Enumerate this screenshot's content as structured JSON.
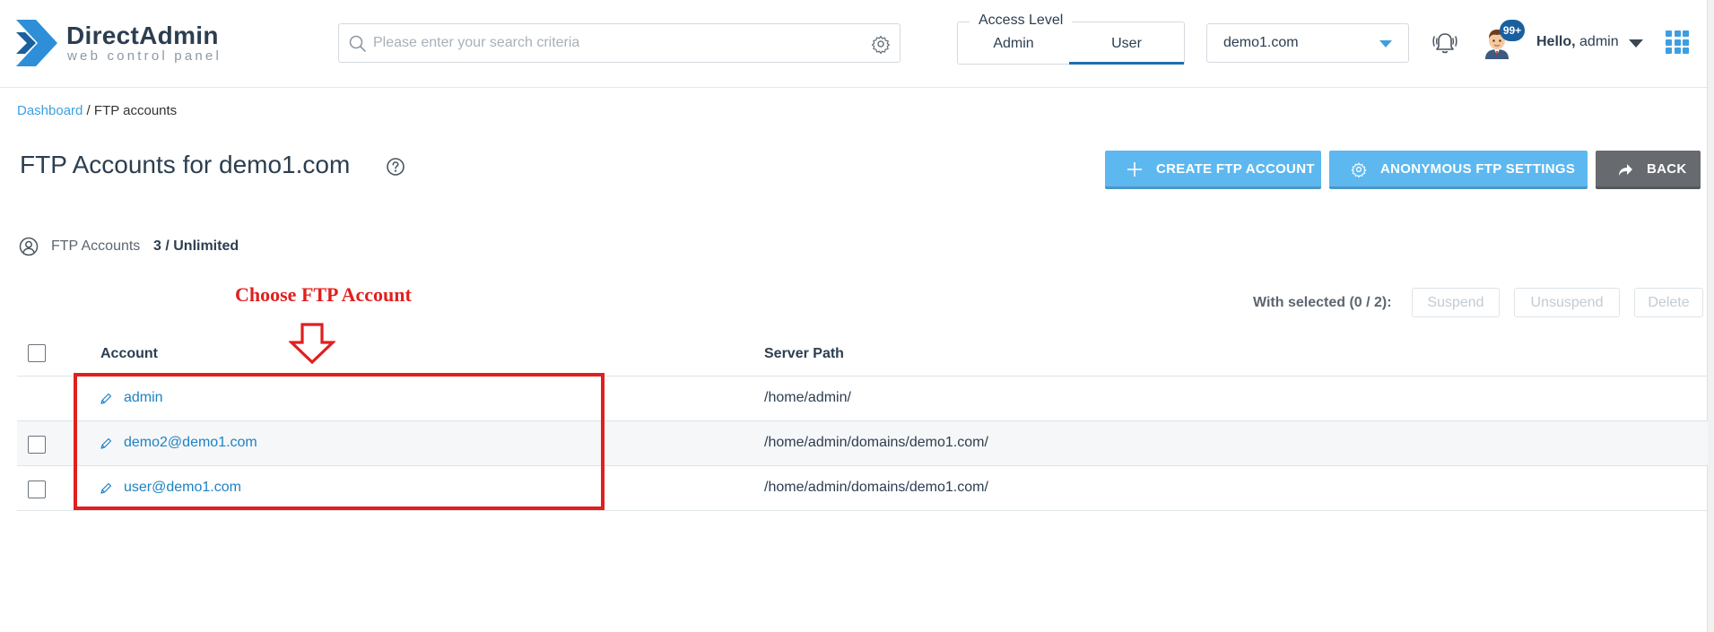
{
  "header": {
    "logo_title": "DirectAdmin",
    "logo_subtitle": "web control panel",
    "search_placeholder": "Please enter your search criteria",
    "access_level_label": "Access Level",
    "access_tabs": [
      "Admin",
      "User"
    ],
    "access_active": "User",
    "domain_selected": "demo1.com",
    "notification_badge": "99+",
    "hello_prefix": "Hello,",
    "hello_user": "admin"
  },
  "breadcrumb": {
    "root": "Dashboard",
    "separator": " / ",
    "current": "FTP accounts"
  },
  "page": {
    "title": "FTP Accounts for demo1.com"
  },
  "actions": {
    "create": "CREATE FTP ACCOUNT",
    "anonymous": "ANONYMOUS FTP SETTINGS",
    "back": "BACK"
  },
  "stats": {
    "label": "FTP Accounts",
    "value": "3 / Unlimited"
  },
  "annotation": {
    "text": "Choose FTP Account",
    "color": "#e0201f"
  },
  "selection": {
    "label": "With selected (0 / 2):",
    "suspend": "Suspend",
    "unsuspend": "Unsuspend",
    "delete": "Delete"
  },
  "table": {
    "headers": {
      "account": "Account",
      "server_path": "Server Path"
    },
    "rows": [
      {
        "account": "admin",
        "path": "/home/admin/",
        "selectable": false
      },
      {
        "account": "demo2@demo1.com",
        "path": "/home/admin/domains/demo1.com/",
        "selectable": true
      },
      {
        "account": "user@demo1.com",
        "path": "/home/admin/domains/demo1.com/",
        "selectable": true
      }
    ]
  },
  "colors": {
    "accent": "#5db8f0",
    "link": "#1d82c4",
    "back_button": "#676b70",
    "logo_blue": "#2e8fd8"
  }
}
